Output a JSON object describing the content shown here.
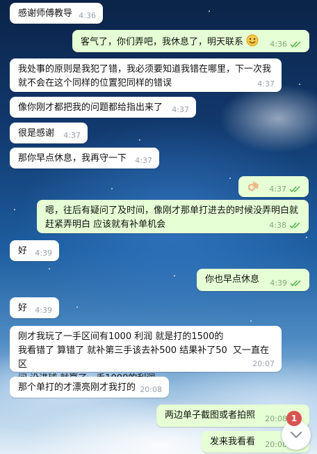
{
  "chat": {
    "messages": [
      {
        "text": "感谢师傅教导",
        "time": "4:36"
      },
      {
        "text": "客气了，你们弄吧，我休息了，明天联系",
        "emoji": "smile-emoji",
        "time": "4:36",
        "status": "read"
      },
      {
        "text": "我处事的原则是我犯了错，我必须要知道我错在哪里，下一次我\n就不会在这个同样的位置犯同样的错误",
        "time": "4:37"
      },
      {
        "text": "像你刚才都把我的问题都给指出来了",
        "time": "4:37"
      },
      {
        "text": "很是感谢",
        "time": "4:37"
      },
      {
        "text": "那你早点休息，我再守一下",
        "time": "4:37"
      },
      {
        "emoji": "ok-hand-emoji",
        "time": "4:37",
        "status": "read"
      },
      {
        "text": "嗯，往后有疑问了及时间，像刚才那单打进去的时候没弄明白就\n赶紧弄明白 应该就有补单机会",
        "time": "4:38",
        "status": "read"
      },
      {
        "text": "好",
        "time": "4:39"
      },
      {
        "text": "你也早点休息",
        "time": "4:39",
        "status": "read"
      },
      {
        "text": "好",
        "time": "4:39"
      },
      {
        "text": "刚才我玩了一手区间有1000 利润 就是打的1500的\n我看错了 算错了 就补第三手该去补500 结果补了50  又一直在区\n间 没进球 就赢了一手1000的利润",
        "time": "20:07"
      },
      {
        "text": "那个单打的才漂亮刚才我打的",
        "time": "20:08"
      },
      {
        "text": "两边单子截图或者拍照",
        "time": "20:08",
        "status": "read"
      },
      {
        "text": "发来我看看",
        "time": "20:08",
        "status": "read"
      }
    ],
    "unread_count": "1"
  }
}
